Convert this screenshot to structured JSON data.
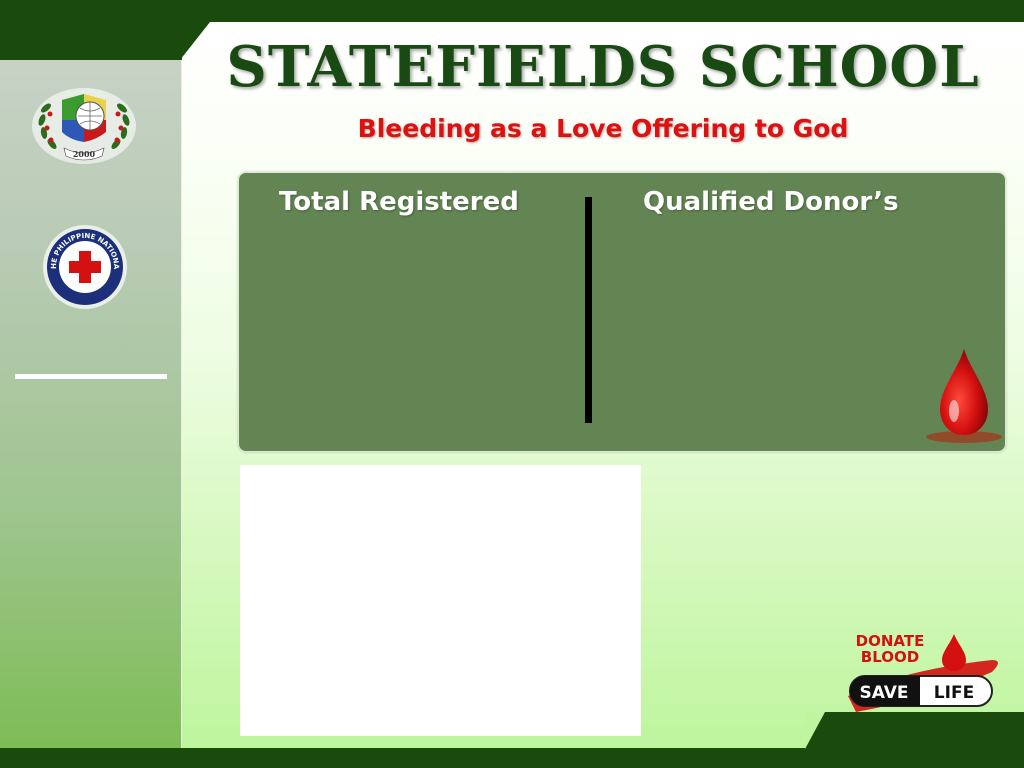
{
  "slide": {
    "title": "STATEFIELDS SCHOOL",
    "subtitle": "Bleeding as a Love Offering to God"
  },
  "board": {
    "left_label": "Total Registered",
    "right_label": "Qualified Donor’s"
  },
  "logos": {
    "school_year": "2000",
    "red_cross_text": "THE PHILIPPINE NATIONAL RED CROSS",
    "donate_line1": "DONATE",
    "donate_line2": "BLOOD",
    "save": "SAVE",
    "life": "LIFE"
  },
  "colors": {
    "frame_dark_green": "#1a4a0c",
    "board_green": "#638553",
    "title_green": "#1a4a14",
    "subtitle_red": "#e01010",
    "blood_red": "#d41010"
  },
  "icons": [
    "school-seal-icon",
    "red-cross-logo-icon",
    "blood-drop-icon",
    "donate-blood-logo-icon"
  ]
}
